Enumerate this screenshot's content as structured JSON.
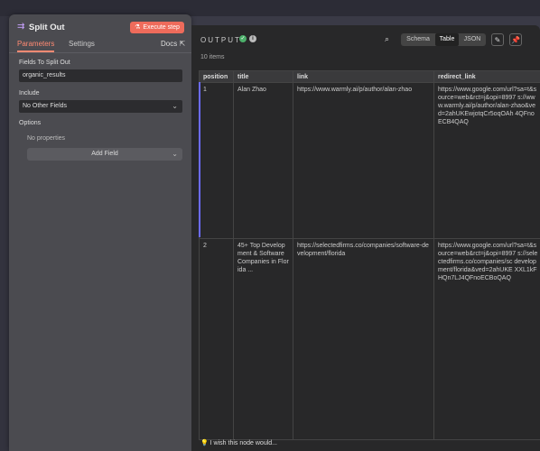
{
  "node": {
    "title": "Split Out",
    "execute_label": "Execute step",
    "tabs": [
      "Parameters",
      "Settings"
    ],
    "docs_label": "Docs"
  },
  "params": {
    "fields_label": "Fields To Split Out",
    "fields_value": "organic_results",
    "include_label": "Include",
    "include_value": "No Other Fields",
    "options_label": "Options",
    "no_properties": "No properties",
    "add_field_label": "Add Field"
  },
  "output": {
    "title": "OUTPUT",
    "items_count": "10 items",
    "views": [
      "Schema",
      "Table",
      "JSON"
    ],
    "active_view": "Table",
    "columns": [
      "position",
      "title",
      "link",
      "redirect_link"
    ],
    "rows": [
      {
        "position": "1",
        "title": "Alan Zhao",
        "link": "https://www.warmly.ai/p/author/alan-zhao",
        "redirect_link": "https://www.google.com/url?sa=t&source=web&rct=j&opi=8997 s://www.warmly.ai/p/author/alan-zhao&ved=2ahUKEwjotqCr5oqOAh 4QFnoECB4QAQ"
      },
      {
        "position": "2",
        "title": "45+ Top Development & Software Companies in Florida ...",
        "link": "https://selectedfirms.co/companies/software-development/florida",
        "redirect_link": "https://www.google.com/url?sa=t&source=web&rct=j&opi=8997 s://selectedfirms.co/companies/sc development/florida&ved=2ahUKE XXL1kFHQn7LJ4QFnoECBoQAQ"
      }
    ]
  },
  "feedback": "I wish this node would...",
  "colors": {
    "accent": "#ff8a73",
    "execute": "#ee6b5b",
    "success": "#4caf6a"
  }
}
